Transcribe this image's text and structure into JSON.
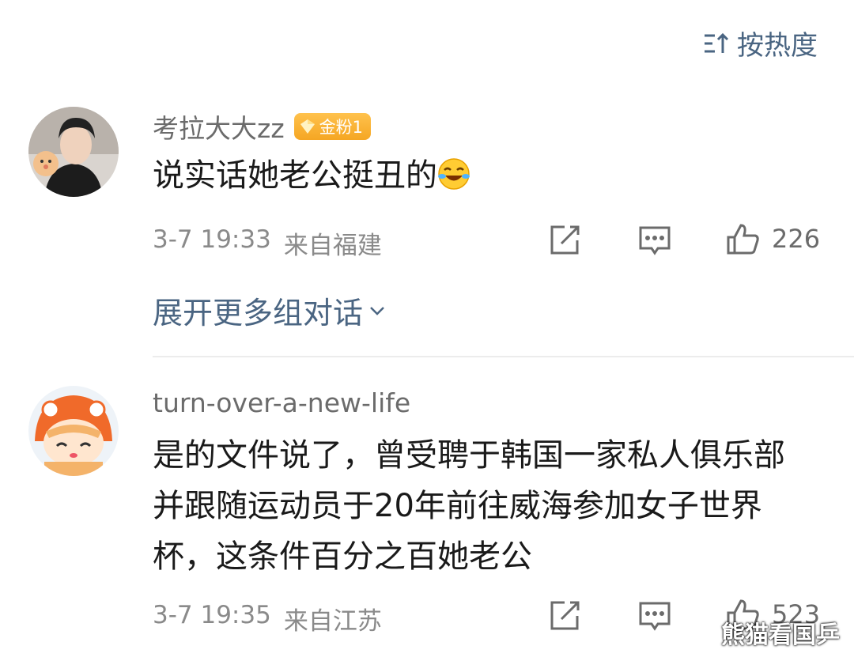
{
  "sort": {
    "label": "按热度",
    "icon": "sort-icon"
  },
  "comments": [
    {
      "username": "考拉大大zz",
      "badge": "金粉1",
      "text": "说实话她老公挺丑的",
      "emoji": "laughing-crying-emoji",
      "time": "3-7 19:33",
      "location": "来自福建",
      "likes": "226"
    },
    {
      "username": "turn-over-a-new-life",
      "text": "是的文件说了，曾受聘于韩国一家私人俱乐部并跟随运动员于20年前往威海参加女子世界杯，这条件百分之百她老公",
      "time": "3-7 19:35",
      "location": "来自江苏",
      "likes": "523"
    }
  ],
  "expand_label": "展开更多组对话",
  "watermark": "熊猫看国乒",
  "colors": {
    "link": "#4a6582",
    "badge": "#f5a623",
    "text": "#1a1a1a",
    "meta": "#8a8a8a"
  }
}
